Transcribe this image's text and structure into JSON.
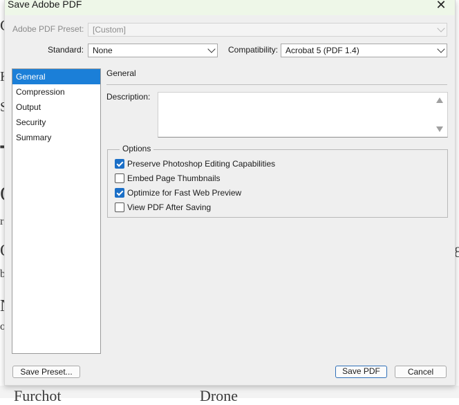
{
  "dialog": {
    "title": "Save Adobe PDF",
    "close_glyph": "✕"
  },
  "preset": {
    "label": "Adobe PDF Preset:",
    "value": "[Custom]"
  },
  "standard": {
    "label": "Standard:",
    "value": "None"
  },
  "compatibility": {
    "label": "Compatibility:",
    "value": "Acrobat 5 (PDF 1.4)"
  },
  "sidebar": {
    "items": [
      {
        "label": "General",
        "selected": true
      },
      {
        "label": "Compression"
      },
      {
        "label": "Output"
      },
      {
        "label": "Security"
      },
      {
        "label": "Summary"
      }
    ]
  },
  "general": {
    "section_title": "General",
    "description_label": "Description:",
    "description_value": ""
  },
  "options": {
    "legend": "Options",
    "items": [
      {
        "label": "Preserve Photoshop Editing Capabilities",
        "checked": true
      },
      {
        "label": "Embed Page Thumbnails",
        "checked": false
      },
      {
        "label": "Optimize for Fast Web Preview",
        "checked": true
      },
      {
        "label": "View PDF After Saving",
        "checked": false
      }
    ]
  },
  "buttons": {
    "save_preset": "Save Preset...",
    "save_pdf": "Save PDF",
    "cancel": "Cancel"
  },
  "background": {
    "frags": [
      "C",
      "K",
      "S",
      "T",
      "O",
      "r",
      "Q",
      "b",
      "N",
      "o",
      "8"
    ],
    "bottom_left": "Furchot",
    "bottom_mid": "Drone"
  },
  "colors": {
    "selection": "#1b7fd8",
    "checkbox_checked": "#1b6fc7",
    "titlebar": "#eef7e8"
  }
}
